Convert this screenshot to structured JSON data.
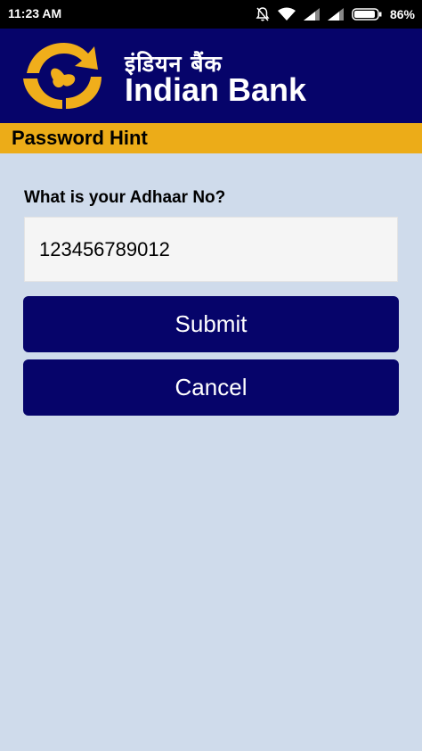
{
  "status_bar": {
    "time": "11:23 AM",
    "battery_percent": "86%",
    "icons": [
      "bell-muted-icon",
      "wifi-icon",
      "signal-icon",
      "signal-icon",
      "battery-icon"
    ]
  },
  "header": {
    "bank_name_hindi": "इंडियन बैंक",
    "bank_name_english": "Indian Bank",
    "logo_icon": "indian-bank-logo",
    "colors": {
      "header_bg": "#06046a",
      "logo_gold": "#f0ae1b"
    }
  },
  "page": {
    "title": "Password Hint",
    "title_bar_color": "#ecac18",
    "background": "#cfdbeb"
  },
  "form": {
    "question_label": "What is your Adhaar No?",
    "aadhaar_value": "123456789012",
    "submit_label": "Submit",
    "cancel_label": "Cancel",
    "button_color": "#06046a"
  }
}
